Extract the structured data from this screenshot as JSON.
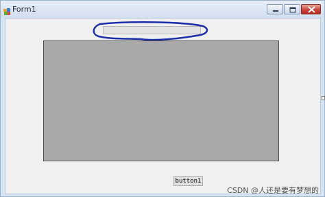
{
  "window": {
    "title": "Form1",
    "controls": {
      "minimize_icon": "minimize-icon",
      "maximize_icon": "maximize-icon",
      "close_icon": "close-icon"
    }
  },
  "form": {
    "textbox_value": "",
    "button_label": "button1",
    "panel_color": "#a9a9a9",
    "annotation_color": "#1c2fa8"
  },
  "watermark": "CSDN @人还是要有梦想的"
}
